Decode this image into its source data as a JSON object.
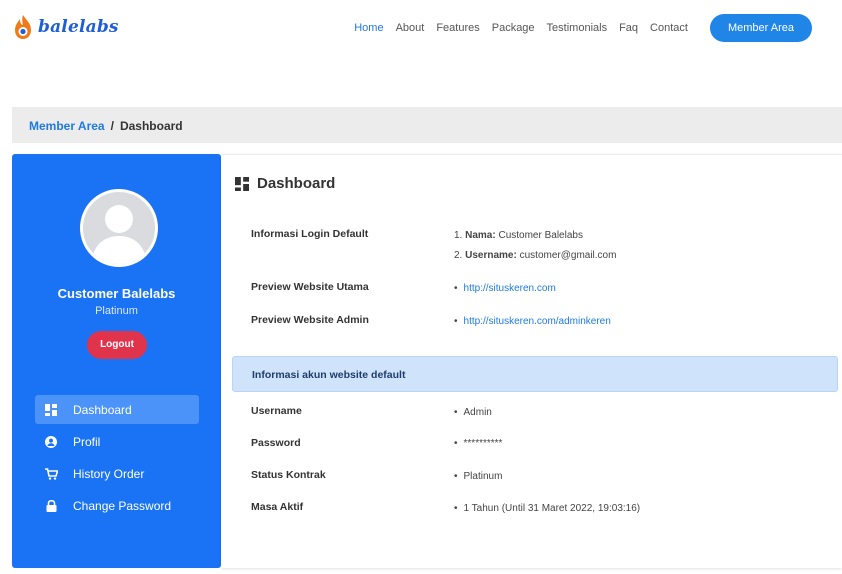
{
  "brand": {
    "name": "balelabs"
  },
  "nav": {
    "links": [
      "Home",
      "About",
      "Features",
      "Package",
      "Testimonials",
      "Faq",
      "Contact"
    ],
    "active": "Home",
    "member_button": "Member Area"
  },
  "breadcrumb": {
    "parent": "Member Area",
    "separator": "/",
    "current": "Dashboard"
  },
  "sidebar": {
    "user_name": "Customer Balelabs",
    "plan": "Platinum",
    "logout_label": "Logout",
    "menu": [
      {
        "label": "Dashboard",
        "icon": "dashboard-icon",
        "active": true
      },
      {
        "label": "Profil",
        "icon": "user-circle-icon",
        "active": false
      },
      {
        "label": "History Order",
        "icon": "cart-icon",
        "active": false
      },
      {
        "label": "Change Password",
        "icon": "lock-icon",
        "active": false
      }
    ]
  },
  "main": {
    "title": "Dashboard",
    "login_info": {
      "label": "Informasi Login Default",
      "line1_prefix": "1. ",
      "line1_key": "Nama:",
      "line1_value": " Customer Balelabs",
      "line2_prefix": "2. ",
      "line2_key": "Username:",
      "line2_value": " customer@gmail.com"
    },
    "preview_main": {
      "label": "Preview Website Utama",
      "url": "http://situskeren.com"
    },
    "preview_admin": {
      "label": "Preview Website Admin",
      "url": "http://situskeren.com/adminkeren"
    },
    "info_bar": "Informasi akun website default",
    "account": [
      {
        "label": "Username",
        "value": "Admin"
      },
      {
        "label": "Password",
        "value": "**********"
      },
      {
        "label": "Status Kontrak",
        "value": "Platinum"
      },
      {
        "label": "Masa Aktif",
        "value": "1 Tahun (Until 31 Maret 2022, 19:03:16)"
      }
    ]
  },
  "colors": {
    "primary": "#1a73f5",
    "accent": "#1f86e8",
    "danger": "#e0344d",
    "info_bg": "#cfe3fb"
  }
}
